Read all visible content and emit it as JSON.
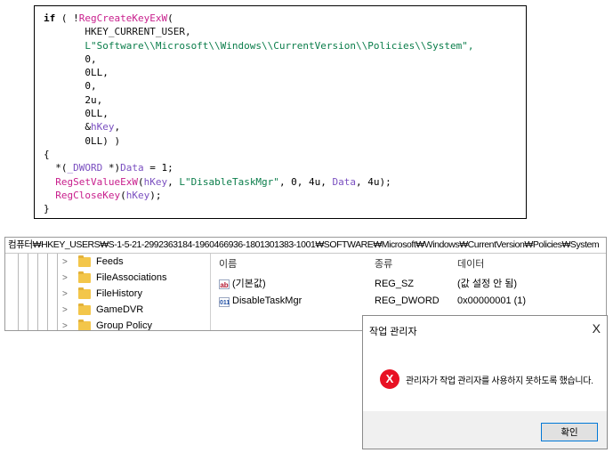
{
  "code": {
    "lines": [
      "if ( !RegCreateKeyExW(",
      "       HKEY_CURRENT_USER,",
      "       L\"Software\\\\Microsoft\\\\Windows\\\\CurrentVersion\\\\Policies\\\\System\",",
      "       0,",
      "       0LL,",
      "       0,",
      "       2u,",
      "       0LL,",
      "       &hKey,",
      "       0LL) )",
      "{",
      "  *(_DWORD *)Data = 1;",
      "  RegSetValueExW(hKey, L\"DisableTaskMgr\", 0, 4u, Data, 4u);",
      "  RegCloseKey(hKey);",
      "}"
    ]
  },
  "registry": {
    "path": "컴퓨터₩HKEY_USERS₩S-1-5-21-2992363184-1960466936-1801301383-1001₩SOFTWARE₩Microsoft₩Windows₩CurrentVersion₩Policies₩System",
    "tree_items": [
      "Feeds",
      "FileAssociations",
      "FileHistory",
      "GameDVR",
      "Group Policy"
    ],
    "columns": {
      "name": "이름",
      "type": "종류",
      "data": "데이터"
    },
    "values": [
      {
        "icon": "string-value-icon",
        "name": "(기본값)",
        "type": "REG_SZ",
        "data": "(값 설정 안 됨)"
      },
      {
        "icon": "dword-value-icon",
        "name": "DisableTaskMgr",
        "type": "REG_DWORD",
        "data": "0x00000001 (1)"
      }
    ]
  },
  "dialog": {
    "title": "작업 관리자",
    "close": "X",
    "message": "관리자가 작업 관리자를 사용하지 못하도록 했습니다.",
    "ok_label": "확인",
    "error_icon": "X"
  },
  "colors": {
    "error": "#e81123",
    "accent": "#0078d7",
    "function": "#c81e8c",
    "string": "#0a7d4a"
  }
}
